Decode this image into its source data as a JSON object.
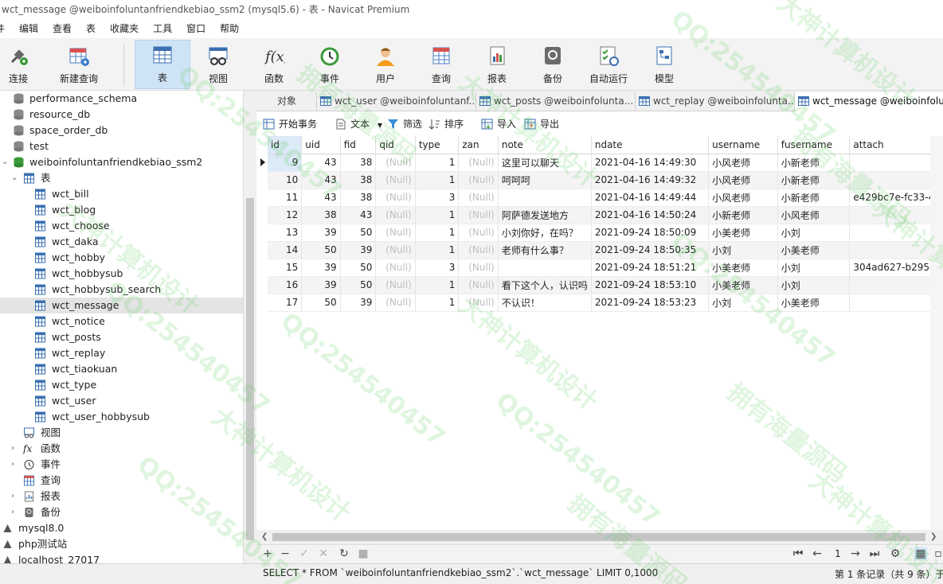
{
  "window": {
    "title": "wct_message @weiboinfoluntanfriendkebiao_ssm2 (mysql5.6) - 表 - Navicat Premium"
  },
  "menu": [
    "件",
    "编辑",
    "查看",
    "表",
    "收藏夹",
    "工具",
    "窗口",
    "帮助"
  ],
  "toolbar": {
    "connect": "连接",
    "new_query": "新建查询",
    "table": "表",
    "view": "视图",
    "function": "函数",
    "event": "事件",
    "user": "用户",
    "query": "查询",
    "report": "报表",
    "backup": "备份",
    "auto_run": "自动运行",
    "model": "模型"
  },
  "tree": {
    "databases": [
      "performance_schema",
      "resource_db",
      "space_order_db",
      "test",
      "weiboinfoluntanfriendkebiao_ssm2"
    ],
    "tables_group": "表",
    "tables": [
      "wct_bill",
      "wct_blog",
      "wct_choose",
      "wct_daka",
      "wct_hobby",
      "wct_hobbysub",
      "wct_hobbysub_search",
      "wct_message",
      "wct_notice",
      "wct_posts",
      "wct_replay",
      "wct_tiaokuan",
      "wct_type",
      "wct_user",
      "wct_user_hobbysub"
    ],
    "selected_table": "wct_message",
    "groups": [
      "视图",
      "函数",
      "事件",
      "查询",
      "报表",
      "备份"
    ],
    "connections": [
      "mysql8.0",
      "php测试站",
      "localhost_27017"
    ]
  },
  "tabs": [
    "对象",
    "wct_user @weiboinfoluntanf...",
    "wct_posts @weiboinfolunta...",
    "wct_replay @weiboinfolunta...",
    "wct_message @weiboinfolu..."
  ],
  "table_toolbar": {
    "begin_tx": "开始事务",
    "text": "文本",
    "filter": "筛选",
    "sort": "排序",
    "import": "导入",
    "export": "导出"
  },
  "grid": {
    "columns": [
      "id",
      "uid",
      "fid",
      "qid",
      "type",
      "zan",
      "note",
      "ndate",
      "username",
      "fusername",
      "attach"
    ],
    "rows": [
      [
        "9",
        "43",
        "38",
        "(Null)",
        "1",
        "(Null)",
        "这里可以聊天",
        "2021-04-16 14:49:30",
        "小风老师",
        "小新老师",
        ""
      ],
      [
        "10",
        "43",
        "38",
        "(Null)",
        "1",
        "(Null)",
        "呵呵呵",
        "2021-04-16 14:49:32",
        "小风老师",
        "小新老师",
        ""
      ],
      [
        "11",
        "43",
        "38",
        "(Null)",
        "3",
        "(Null)",
        "",
        "2021-04-16 14:49:44",
        "小风老师",
        "小新老师",
        "e429bc7e-fc33-4"
      ],
      [
        "12",
        "38",
        "43",
        "(Null)",
        "1",
        "(Null)",
        "阿萨德发送地方",
        "2021-04-16 14:50:24",
        "小新老师",
        "小风老师",
        ""
      ],
      [
        "13",
        "39",
        "50",
        "(Null)",
        "1",
        "(Null)",
        "小刘你好，在吗？",
        "2021-09-24 18:50:09",
        "小美老师",
        "小刘",
        ""
      ],
      [
        "14",
        "50",
        "39",
        "(Null)",
        "1",
        "(Null)",
        "老师有什么事？",
        "2021-09-24 18:50:35",
        "小刘",
        "小美老师",
        ""
      ],
      [
        "15",
        "39",
        "50",
        "(Null)",
        "3",
        "(Null)",
        "",
        "2021-09-24 18:51:21",
        "小美老师",
        "小刘",
        "304ad627-b295-4"
      ],
      [
        "16",
        "39",
        "50",
        "(Null)",
        "1",
        "(Null)",
        "看下这个人，认识吗",
        "2021-09-24 18:53:10",
        "小美老师",
        "小刘",
        ""
      ],
      [
        "17",
        "50",
        "39",
        "(Null)",
        "1",
        "(Null)",
        "不认识！",
        "2021-09-24 18:53:23",
        "小刘",
        "小美老师",
        ""
      ]
    ]
  },
  "nav": {
    "page": "1"
  },
  "status": {
    "sql": "SELECT * FROM `weiboinfoluntanfriendkebiao_ssm2`.`wct_message` LIMIT 0,1000",
    "records": "第 1 条记录（共 9 条）于"
  },
  "watermark": [
    "QQ:254540457",
    "大神计算机设计",
    "拥有海量源码"
  ]
}
